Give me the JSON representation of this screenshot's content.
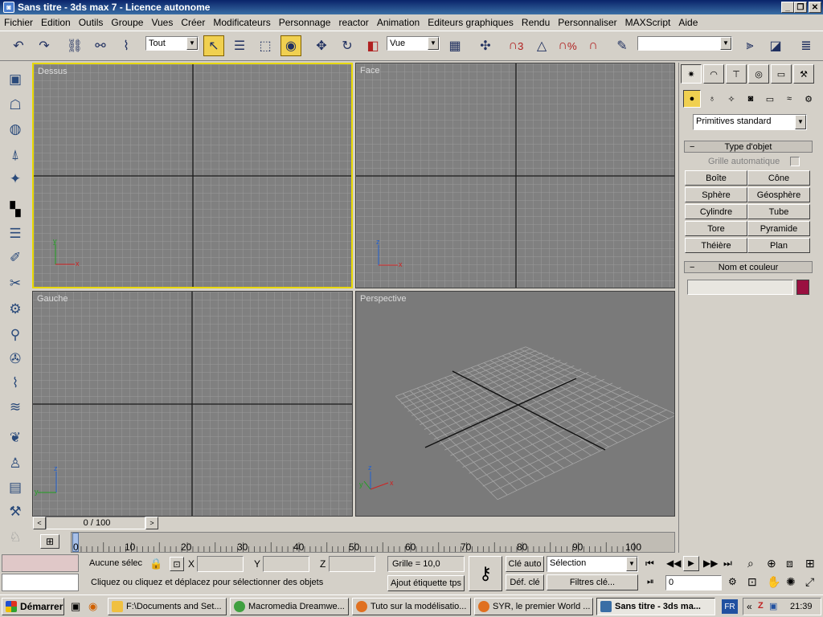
{
  "window": {
    "title": "Sans titre - 3ds max 7 - Licence autonome",
    "minimize": "_",
    "maximize": "❐",
    "close": "✕"
  },
  "menu": [
    "Fichier",
    "Edition",
    "Outils",
    "Groupe",
    "Vues",
    "Créer",
    "Modificateurs",
    "Personnage",
    "reactor",
    "Animation",
    "Editeurs graphiques",
    "Rendu",
    "Personnaliser",
    "MAXScript",
    "Aide"
  ],
  "toolbar": {
    "filter_value": "Tout",
    "refcoord_value": "Vue",
    "snap_3d": "3",
    "percent": "%",
    "named_selection_value": ""
  },
  "viewports": {
    "top": "Dessus",
    "front": "Face",
    "left": "Gauche",
    "perspective": "Perspective"
  },
  "axes": {
    "x": "x",
    "y": "y",
    "z": "z"
  },
  "command_panel": {
    "category_value": "Primitives standard",
    "object_type_header": "Type d'objet",
    "autogrid_label": "Grille automatique",
    "buttons": [
      "Boîte",
      "Cône",
      "Sphère",
      "Géosphère",
      "Cylindre",
      "Tube",
      "Tore",
      "Pyramide",
      "Théière",
      "Plan"
    ],
    "name_color_header": "Nom et couleur",
    "object_color": "#9a1040"
  },
  "timeline": {
    "frame_counter": "0 / 100",
    "ticks": [
      "0",
      "10",
      "20",
      "30",
      "40",
      "50",
      "60",
      "70",
      "80",
      "90",
      "100"
    ]
  },
  "status": {
    "selection_status": "Aucune sélec",
    "prompt": "Cliquez ou cliquez et déplacez pour sélectionner des objets",
    "x_label": "X",
    "y_label": "Y",
    "z_label": "Z",
    "grid": "Grille = 10,0",
    "add_tag": "Ajout étiquette tps",
    "auto_key": "Clé auto",
    "set_key": "Déf. clé",
    "key_mode_value": "Sélection",
    "key_filters": "Filtres clé...",
    "current_frame": "0"
  },
  "taskbar": {
    "start": "Démarrer",
    "tasks": [
      "F:\\Documents and Set...",
      "Macromedia Dreamwe...",
      "Tuto sur la modélisatio...",
      "SYR, le premier World ...",
      "Sans titre - 3ds ma..."
    ],
    "lang": "FR",
    "clock": "21:39"
  }
}
